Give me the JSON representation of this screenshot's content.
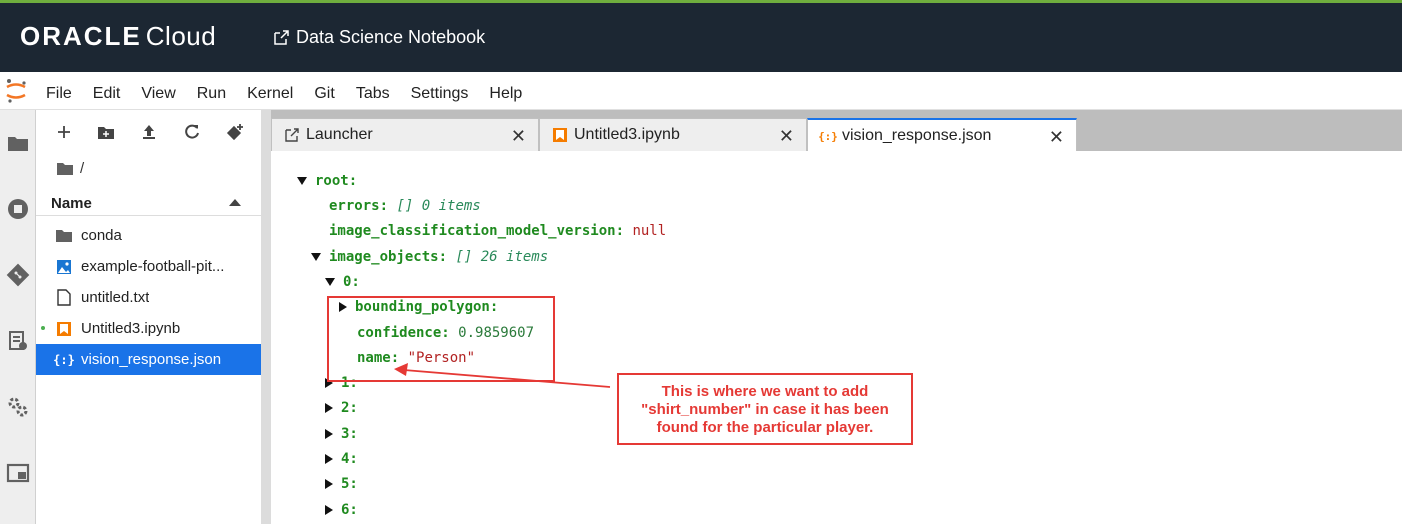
{
  "header": {
    "brand_bold": "ORACLE",
    "brand_light": "Cloud",
    "notebook_title": "Data Science Notebook"
  },
  "menu": [
    "File",
    "Edit",
    "View",
    "Run",
    "Kernel",
    "Git",
    "Tabs",
    "Settings",
    "Help"
  ],
  "filebrowser": {
    "breadcrumb": "/",
    "column_name": "Name",
    "items": [
      {
        "name": "conda",
        "icon": "folder-icon"
      },
      {
        "name": "example-football-pit...",
        "icon": "image-icon"
      },
      {
        "name": "untitled.txt",
        "icon": "file-icon"
      },
      {
        "name": "Untitled3.ipynb",
        "icon": "notebook-icon"
      },
      {
        "name": "vision_response.json",
        "icon": "json-icon"
      }
    ]
  },
  "tabs": [
    {
      "label": "Launcher",
      "icon": "launcher-icon"
    },
    {
      "label": "Untitled3.ipynb",
      "icon": "notebook-icon"
    },
    {
      "label": "vision_response.json",
      "icon": "json-icon"
    }
  ],
  "json_view": {
    "root": "root:",
    "errors_key": "errors:",
    "errors_meta": "[] 0 items",
    "icmv_key": "image_classification_model_version:",
    "icmv_val": "null",
    "image_objects_key": "image_objects:",
    "image_objects_meta": "[] 26 items",
    "item0": "0:",
    "bounding_polygon": "bounding_polygon:",
    "confidence_key": "confidence:",
    "confidence_val": "0.9859607",
    "name_key": "name:",
    "name_val": "\"Person\"",
    "item1": "1:",
    "item2": "2:",
    "item3": "3:",
    "item4": "4:",
    "item5": "5:",
    "item6": "6:"
  },
  "annotation": {
    "line1": "This is where we want to add",
    "line2": "\"shirt_number\" in case it has been",
    "line3": "found for the particular player."
  },
  "colors": {
    "accent": "#1a73e8",
    "annotation_red": "#e53935",
    "json_key": "#1f8a1f"
  }
}
